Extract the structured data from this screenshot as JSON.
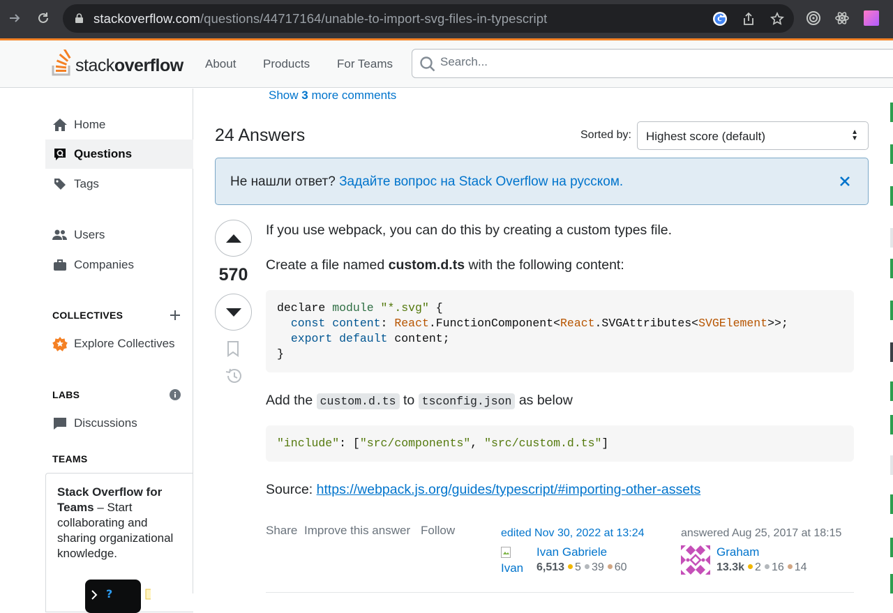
{
  "browser": {
    "url_host": "stackoverflow.com",
    "url_path": "/questions/44717164/unable-to-import-svg-files-in-typescript",
    "icons": [
      "forward-icon",
      "reload-icon",
      "lock-icon",
      "google-icon",
      "share-icon",
      "star-icon",
      "extension-icon",
      "react-devtools-icon",
      "profile-icon"
    ]
  },
  "header": {
    "logo_light": "stack",
    "logo_bold": "overflow",
    "nav": [
      "About",
      "Products",
      "For Teams"
    ],
    "search_placeholder": "Search..."
  },
  "sidebar": {
    "home": "Home",
    "questions": "Questions",
    "tags": "Tags",
    "users": "Users",
    "companies": "Companies",
    "collectives_title": "COLLECTIVES",
    "explore_collectives": "Explore Collectives",
    "labs_title": "LABS",
    "discussions": "Discussions",
    "teams_title": "TEAMS",
    "teams_promo_bold": "Stack Overflow for Teams",
    "teams_promo_rest": " – Start collaborating and sharing organizational knowledge."
  },
  "main": {
    "show_more_pre": "Show ",
    "show_more_count": "3",
    "show_more_post": " more comments",
    "answers_count": "24 Answers",
    "sorted_by_label": "Sorted by:",
    "sort_value": "Highest score (default)",
    "notice_text": "Не нашли ответ? ",
    "notice_link": "Задайте вопрос на Stack Overflow на русском."
  },
  "answer": {
    "score": "570",
    "p1": "If you use webpack, you can do this by creating a custom types file.",
    "p2_pre": "Create a file named ",
    "p2_bold": "custom.d.ts",
    "p2_post": " with the following content:",
    "p3_pre": "Add the ",
    "p3_code1": "custom.d.ts",
    "p3_mid": " to ",
    "p3_code2": "tsconfig.json",
    "p3_post": " as below",
    "source_label": "Source: ",
    "source_link": "https://webpack.js.org/guides/typescript/#importing-other-assets",
    "menu": [
      "Share",
      "Improve this answer",
      "Follow"
    ],
    "editor": {
      "action": "edited Nov 30, 2022 at 13:24",
      "name": "Ivan Gabriele",
      "avatar_alt": "Ivan Gabri",
      "rep": "6,513",
      "gold": "5",
      "silver": "39",
      "bronze": "60"
    },
    "author": {
      "action": "answered Aug 25, 2017 at 18:15",
      "name": "Graham",
      "rep": "13.3k",
      "gold": "2",
      "silver": "16",
      "bronze": "14"
    }
  },
  "colors": {
    "link": "#0074cc",
    "accent": "#f48225",
    "notice_bg": "#e1ecf4"
  }
}
